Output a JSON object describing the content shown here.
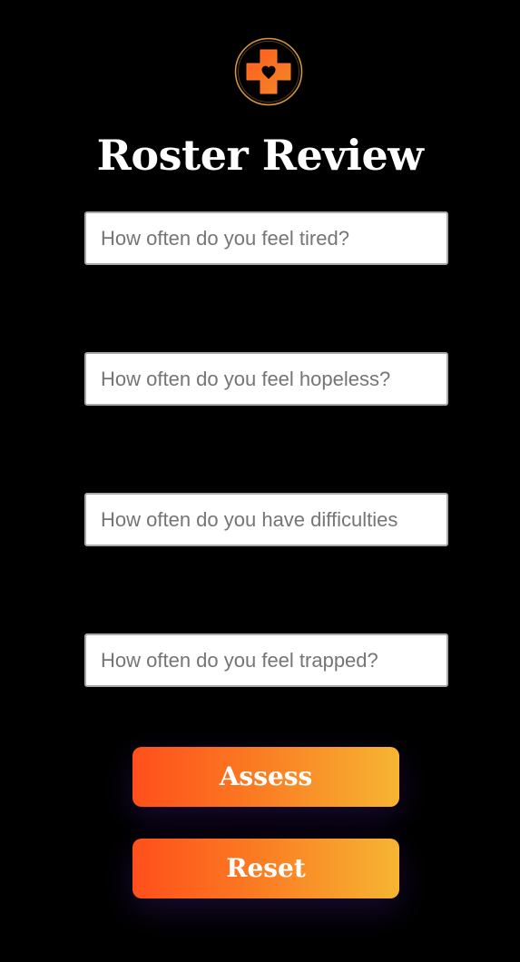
{
  "app": {
    "title": "Roster Review"
  },
  "form": {
    "fields": [
      {
        "value": "",
        "placeholder": "How often do you feel tired?"
      },
      {
        "value": "",
        "placeholder": "How often do you feel hopeless?"
      },
      {
        "value": "",
        "placeholder": "How often do you have difficulties"
      },
      {
        "value": "",
        "placeholder": "How often do you feel trapped?"
      }
    ],
    "assess_label": "Assess",
    "reset_label": "Reset"
  },
  "icons": {
    "logo": "medical-cross-heart-icon"
  },
  "colors": {
    "background": "#000000",
    "title_text": "#ffffff",
    "accent_start": "#ff4f1b",
    "accent_end": "#f6b532",
    "logo_ring": "#d89a3a",
    "heart": "#000000"
  }
}
